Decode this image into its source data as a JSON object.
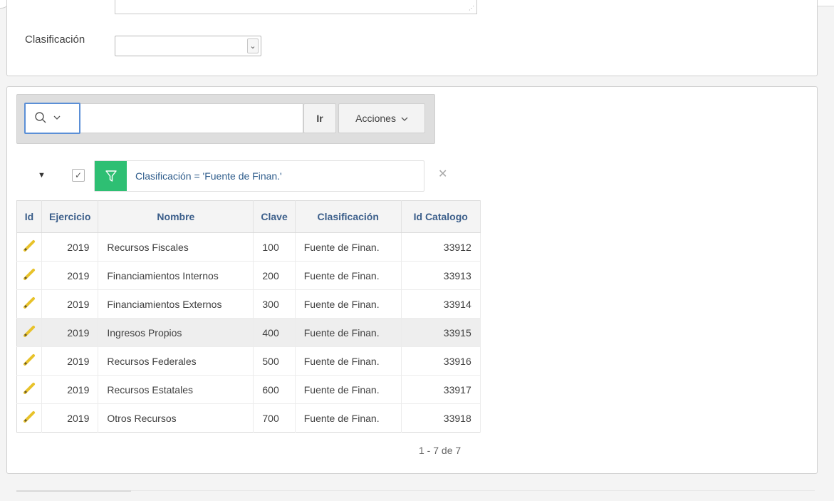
{
  "form": {
    "clasificacion_label": "Clasificación",
    "clasificacion_value": ""
  },
  "toolbar": {
    "search_value": "",
    "go_label": "Ir",
    "actions_label": "Acciones",
    "search_icon": "search-icon",
    "chevron_icon": "chevron-down-icon"
  },
  "filter": {
    "text": "Clasificación = 'Fuente de Finan.'",
    "enabled": true,
    "badge_color": "#2ebf73"
  },
  "table": {
    "columns": [
      "Id",
      "Ejercicio",
      "Nombre",
      "Clave",
      "Clasificación",
      "Id Catalogo"
    ],
    "rows": [
      {
        "ejercicio": "2019",
        "nombre": "Recursos Fiscales",
        "clave": "100",
        "clasificacion": "Fuente de Finan.",
        "id_catalogo": "33912"
      },
      {
        "ejercicio": "2019",
        "nombre": "Financiamientos Internos",
        "clave": "200",
        "clasificacion": "Fuente de Finan.",
        "id_catalogo": "33913"
      },
      {
        "ejercicio": "2019",
        "nombre": "Financiamientos Externos",
        "clave": "300",
        "clasificacion": "Fuente de Finan.",
        "id_catalogo": "33914"
      },
      {
        "ejercicio": "2019",
        "nombre": "Ingresos Propios",
        "clave": "400",
        "clasificacion": "Fuente de Finan.",
        "id_catalogo": "33915"
      },
      {
        "ejercicio": "2019",
        "nombre": "Recursos Federales",
        "clave": "500",
        "clasificacion": "Fuente de Finan.",
        "id_catalogo": "33916"
      },
      {
        "ejercicio": "2019",
        "nombre": "Recursos Estatales",
        "clave": "600",
        "clasificacion": "Fuente de Finan.",
        "id_catalogo": "33917"
      },
      {
        "ejercicio": "2019",
        "nombre": "Otros Recursos",
        "clave": "700",
        "clasificacion": "Fuente de Finan.",
        "id_catalogo": "33918"
      }
    ]
  },
  "pagination": {
    "text": "1 - 7 de 7"
  }
}
